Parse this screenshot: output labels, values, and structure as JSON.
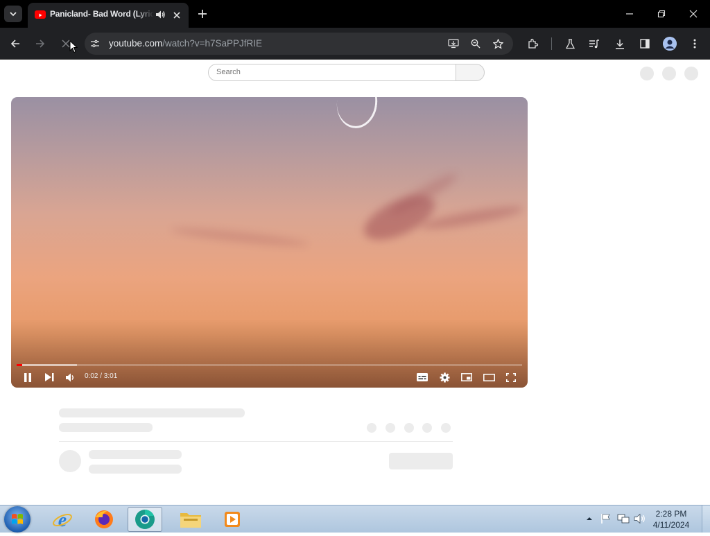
{
  "browser": {
    "tab_title": "Panicland- Bad Word (Lyric",
    "url_host": "youtube.com",
    "url_path": "/watch?v=h7SaPPJfRIE"
  },
  "page": {
    "search_placeholder": "Search"
  },
  "player": {
    "time": "0:02 / 3:01",
    "played_fraction": 0.011,
    "buffered_fraction": 0.12
  },
  "taskbar": {
    "time": "2:28 PM",
    "date": "4/11/2024",
    "apps": [
      "Internet Explorer",
      "Firefox",
      "Chrome",
      "Windows Explorer",
      "Media Player"
    ]
  },
  "colors": {
    "youtube_red": "#ff0000",
    "chrome_dark": "#202124"
  }
}
